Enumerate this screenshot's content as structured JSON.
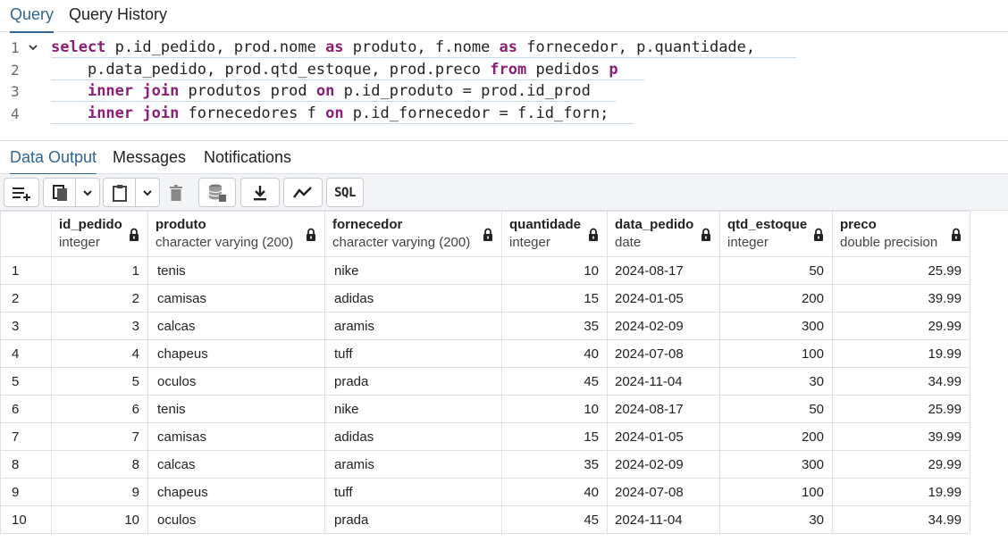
{
  "top_tabs": [
    "Query",
    "Query History"
  ],
  "editor": {
    "line_numbers": [
      "1",
      "2",
      "3",
      "4"
    ],
    "lines": [
      [
        [
          "kw",
          "select"
        ],
        [
          "t",
          " p.id_pedido, prod.nome "
        ],
        [
          "kw",
          "as"
        ],
        [
          "t",
          " produto, f.nome "
        ],
        [
          "kw",
          "as"
        ],
        [
          "t",
          " fornecedor, p.quantidade,"
        ]
      ],
      [
        [
          "t",
          "    p.data_pedido, prod.qtd_estoque, prod.preco "
        ],
        [
          "kw",
          "from"
        ],
        [
          "t",
          " pedidos "
        ],
        [
          "kw",
          "p"
        ]
      ],
      [
        [
          "t",
          "    "
        ],
        [
          "kw",
          "inner join"
        ],
        [
          "t",
          " produtos prod "
        ],
        [
          "kw",
          "on"
        ],
        [
          "t",
          " p.id_produto = prod.id_prod"
        ]
      ],
      [
        [
          "t",
          "    "
        ],
        [
          "kw",
          "inner join"
        ],
        [
          "t",
          " fornecedores f "
        ],
        [
          "kw",
          "on"
        ],
        [
          "t",
          " p.id_fornecedor = f.id_forn;"
        ]
      ]
    ]
  },
  "result_tabs": [
    "Data Output",
    "Messages",
    "Notifications"
  ],
  "toolbar": {
    "sql_label": "SQL"
  },
  "columns": [
    {
      "name": "id_pedido",
      "type": "integer"
    },
    {
      "name": "produto",
      "type": "character varying (200)"
    },
    {
      "name": "fornecedor",
      "type": "character varying (200)"
    },
    {
      "name": "quantidade",
      "type": "integer"
    },
    {
      "name": "data_pedido",
      "type": "date"
    },
    {
      "name": "qtd_estoque",
      "type": "integer"
    },
    {
      "name": "preco",
      "type": "double precision"
    }
  ],
  "rows": [
    [
      "1",
      "1",
      "tenis",
      "nike",
      "10",
      "2024-08-17",
      "50",
      "25.99"
    ],
    [
      "2",
      "2",
      "camisas",
      "adidas",
      "15",
      "2024-01-05",
      "200",
      "39.99"
    ],
    [
      "3",
      "3",
      "calcas",
      "aramis",
      "35",
      "2024-02-09",
      "300",
      "29.99"
    ],
    [
      "4",
      "4",
      "chapeus",
      "tuff",
      "40",
      "2024-07-08",
      "100",
      "19.99"
    ],
    [
      "5",
      "5",
      "oculos",
      "prada",
      "45",
      "2024-11-04",
      "30",
      "34.99"
    ],
    [
      "6",
      "6",
      "tenis",
      "nike",
      "10",
      "2024-08-17",
      "50",
      "25.99"
    ],
    [
      "7",
      "7",
      "camisas",
      "adidas",
      "15",
      "2024-01-05",
      "200",
      "39.99"
    ],
    [
      "8",
      "8",
      "calcas",
      "aramis",
      "35",
      "2024-02-09",
      "300",
      "29.99"
    ],
    [
      "9",
      "9",
      "chapeus",
      "tuff",
      "40",
      "2024-07-08",
      "100",
      "19.99"
    ],
    [
      "10",
      "10",
      "oculos",
      "prada",
      "45",
      "2024-11-04",
      "30",
      "34.99"
    ]
  ],
  "colors": {
    "accent": "#326690",
    "keyword": "#8a1f73"
  }
}
